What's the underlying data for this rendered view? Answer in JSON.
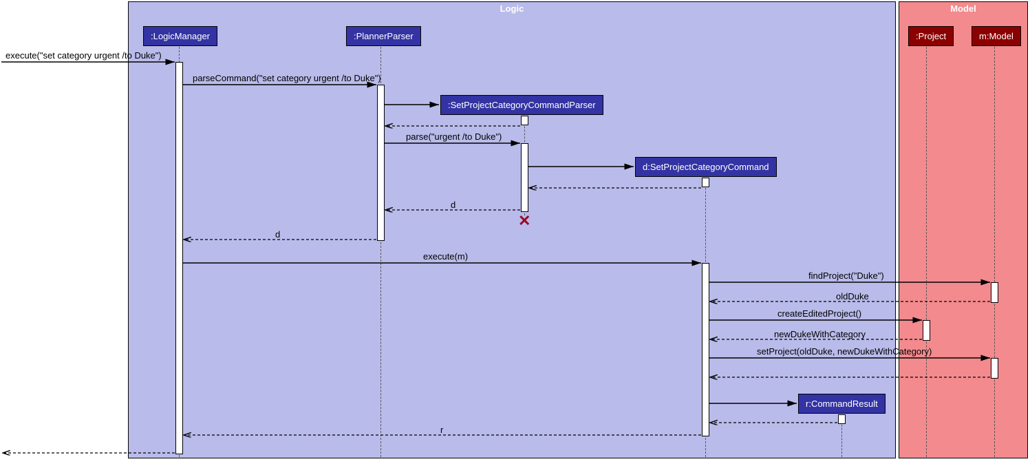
{
  "frames": {
    "logic": "Logic",
    "model": "Model"
  },
  "participants": {
    "logicManager": ":LogicManager",
    "plannerParser": ":PlannerParser",
    "setParser": ":SetProjectCategoryCommandParser",
    "setCommand": "d:SetProjectCategoryCommand",
    "commandResult": "r:CommandResult",
    "project": ":Project",
    "model": "m:Model"
  },
  "messages": {
    "execute1": "execute(\"set category urgent /to Duke\")",
    "parseCommand": "parseCommand(\"set category urgent /to Duke\")",
    "parse": "parse(\"urgent /to Duke\")",
    "retD1": "d",
    "retD2": "d",
    "executeM": "execute(m)",
    "findProject": "findProject(\"Duke\")",
    "oldDuke": "oldDuke",
    "createEdited": "createEditedProject()",
    "newDuke": "newDukeWithCategory",
    "setProject": "setProject(oldDuke, newDukeWithCategory)",
    "retR": "r"
  }
}
